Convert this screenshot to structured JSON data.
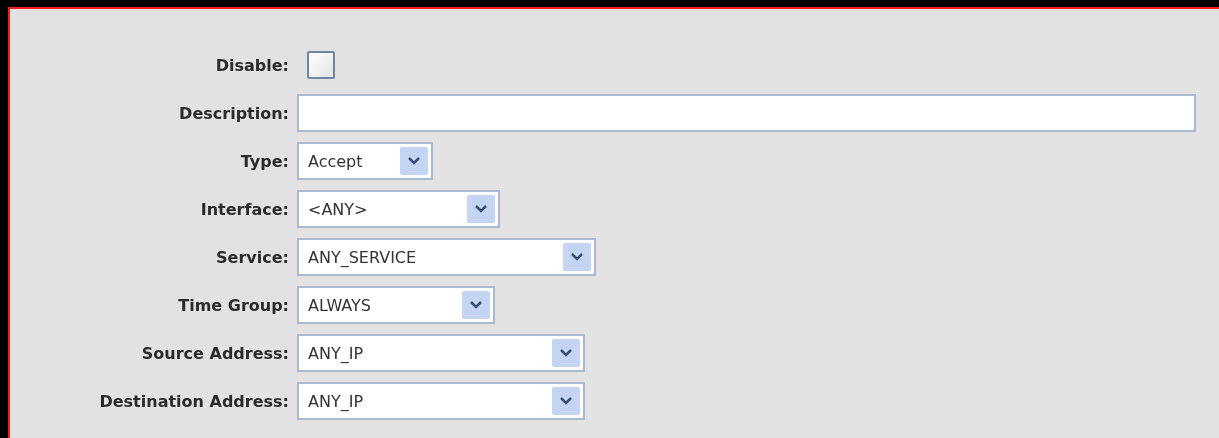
{
  "fields": [
    {
      "kind": "checkbox",
      "label": "Disable:",
      "checked": false
    },
    {
      "kind": "text",
      "label": "Description:"
    },
    {
      "kind": "select",
      "label": "Type:",
      "value": "Accept"
    },
    {
      "kind": "select",
      "label": "Interface:",
      "value": "<ANY>"
    },
    {
      "kind": "select",
      "label": "Service:",
      "value": "ANY_SERVICE"
    },
    {
      "kind": "select",
      "label": "Time Group:",
      "value": "ALWAYS"
    },
    {
      "kind": "select",
      "label": "Source Address:",
      "value": "ANY_IP"
    },
    {
      "kind": "select",
      "label": "Destination Address:",
      "value": "ANY_IP"
    }
  ]
}
